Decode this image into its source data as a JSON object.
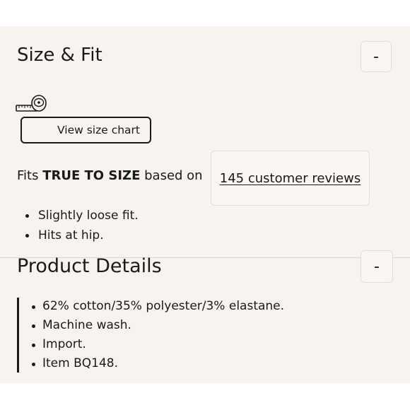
{
  "size_fit": {
    "title": "Size & Fit",
    "toggle_label": "-",
    "size_chart_label": "View size chart",
    "fits_prefix": "Fits ",
    "fits_emphasis": "TRUE TO SIZE",
    "fits_suffix": " based on",
    "reviews_link": "145 customer reviews",
    "bullets": [
      "Slightly loose fit.",
      "Hits at hip."
    ]
  },
  "product_details": {
    "title": "Product Details",
    "toggle_label": "-",
    "bullets": [
      "62% cotton/35% polyester/3% elastane.",
      "Machine wash.",
      "Import.",
      "Item BQ148."
    ]
  },
  "icons": {
    "size_chart": "measuring-tape-icon"
  },
  "colors": {
    "panel_background": "#f7f3ef",
    "text": "#1a1a1a",
    "border": "#e4ddd6"
  }
}
